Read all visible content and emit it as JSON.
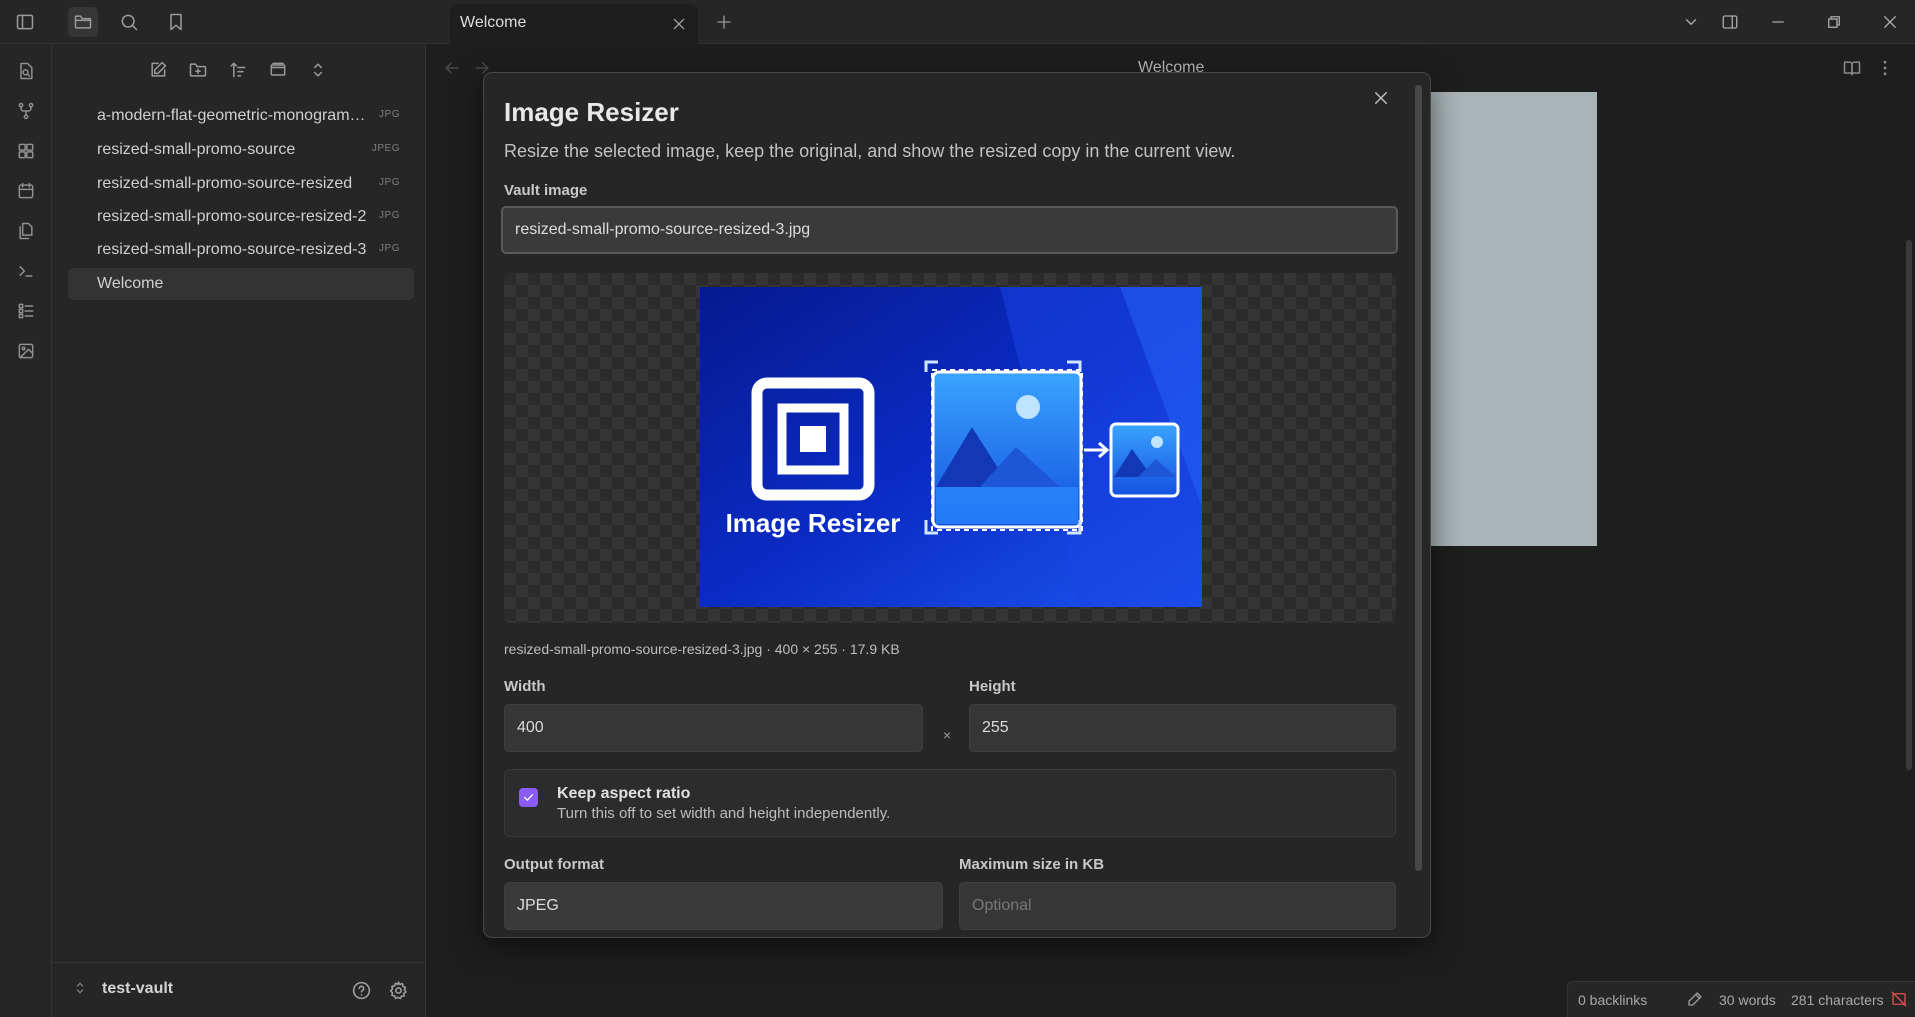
{
  "tab": {
    "title": "Welcome"
  },
  "sidebar": {
    "files": [
      {
        "name": "a-modern-flat-geometric-monogram-logo",
        "ext": "JPG"
      },
      {
        "name": "resized-small-promo-source",
        "ext": "JPEG"
      },
      {
        "name": "resized-small-promo-source-resized",
        "ext": "JPG"
      },
      {
        "name": "resized-small-promo-source-resized-2",
        "ext": "JPG"
      },
      {
        "name": "resized-small-promo-source-resized-3",
        "ext": "JPG"
      },
      {
        "name": "Welcome",
        "ext": ""
      }
    ],
    "vault_name": "test-vault"
  },
  "view": {
    "title": "Welcome"
  },
  "status": {
    "backlinks": "0 backlinks",
    "words": "30 words",
    "characters": "281 characters"
  },
  "modal": {
    "title": "Image Resizer",
    "description": "Resize the selected image, keep the original, and show the resized copy in the current view.",
    "vault_image_label": "Vault image",
    "vault_image_value": "resized-small-promo-source-resized-3.jpg",
    "preview_caption": "Image Resizer",
    "file_meta": "resized-small-promo-source-resized-3.jpg · 400 × 255 · 17.9 KB",
    "width_label": "Width",
    "width_value": "400",
    "times_symbol": "×",
    "height_label": "Height",
    "height_value": "255",
    "keep_aspect_title": "Keep aspect ratio",
    "keep_aspect_desc": "Turn this off to set width and height independently.",
    "output_format_label": "Output format",
    "output_format_value": "JPEG",
    "max_size_label": "Maximum size in KB",
    "max_size_placeholder": "Optional"
  },
  "colors": {
    "accent": "#8a5cf5",
    "promo_bg": "#0a2bc4"
  }
}
